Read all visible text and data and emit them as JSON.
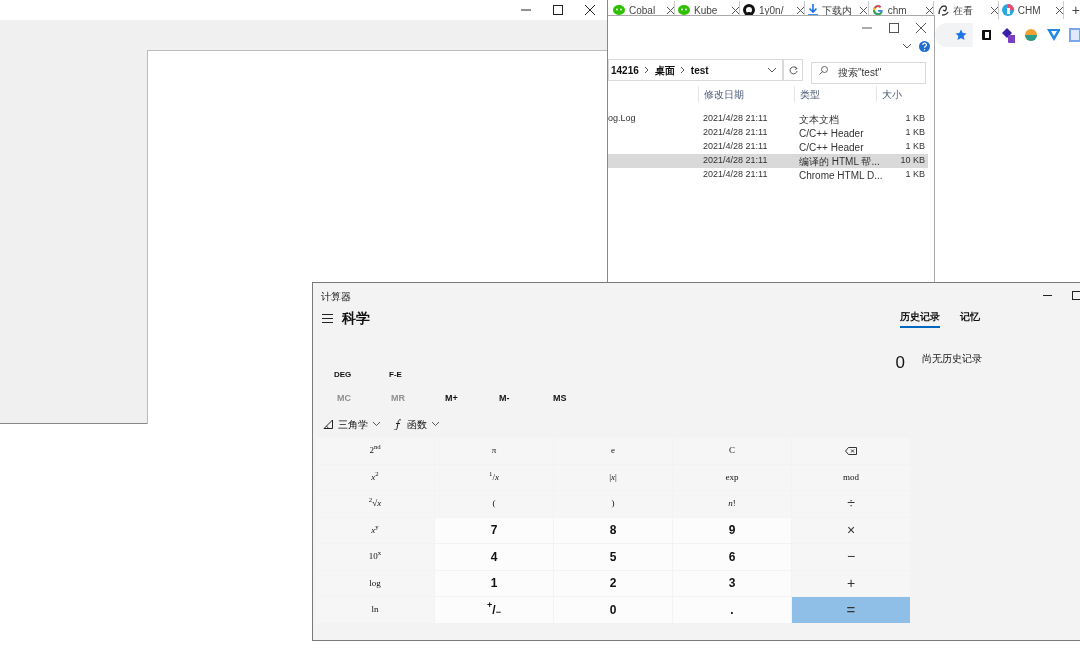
{
  "browser": {
    "tabs": [
      {
        "label": "Cobal"
      },
      {
        "label": "Kube"
      },
      {
        "label": "1y0n/"
      },
      {
        "label": "下载内"
      },
      {
        "label": "chm"
      },
      {
        "label": "在看"
      },
      {
        "label": "CHM"
      }
    ],
    "new_tab": "+"
  },
  "explorer": {
    "breadcrumb": [
      "14216",
      "桌面",
      "test"
    ],
    "search": {
      "placeholder": "搜索\"test\""
    },
    "columns": [
      "修改日期",
      "类型",
      "大小"
    ],
    "rows": [
      {
        "name": "og.Log",
        "date": "2021/4/28 21:11",
        "type": "文本文档",
        "size": "1 KB",
        "selected": false
      },
      {
        "date": "2021/4/28 21:11",
        "type": "C/C++ Header",
        "size": "1 KB",
        "selected": false
      },
      {
        "date": "2021/4/28 21:11",
        "type": "C/C++ Header",
        "size": "1 KB",
        "selected": false
      },
      {
        "date": "2021/4/28 21:11",
        "type": "编译的 HTML 帮...",
        "size": "10 KB",
        "selected": true
      },
      {
        "date": "2021/4/28 21:11",
        "type": "Chrome HTML D...",
        "size": "1 KB",
        "selected": false
      }
    ]
  },
  "calculator": {
    "title": "计算器",
    "mode": "科学",
    "tabs": [
      {
        "label": "历史记录",
        "selected": true
      },
      {
        "label": "记忆",
        "selected": false
      }
    ],
    "display": "0",
    "history_empty": "尚无历史记录",
    "angle_buttons": [
      "DEG",
      "F-E"
    ],
    "memory_buttons": [
      {
        "label": "MC",
        "disabled": true
      },
      {
        "label": "MR",
        "disabled": true
      },
      {
        "label": "M+",
        "disabled": false
      },
      {
        "label": "M-",
        "disabled": false
      },
      {
        "label": "MS",
        "disabled": false
      }
    ],
    "dropdowns": [
      "三角学",
      "函数"
    ],
    "keys": [
      [
        {
          "label": "2$^{nd}$",
          "kind": "function"
        },
        {
          "label": "π",
          "kind": "function"
        },
        {
          "label": "e",
          "kind": "function"
        },
        {
          "label": "C",
          "kind": "function"
        },
        {
          "kind": "backspace"
        }
      ],
      [
        {
          "label": "*x*$^{2}$",
          "kind": "function"
        },
        {
          "label": "$^{1}$/*x*",
          "kind": "function"
        },
        {
          "label": "|*x*|",
          "kind": "function"
        },
        {
          "label": "exp",
          "kind": "function"
        },
        {
          "label": "mod",
          "kind": "function"
        }
      ],
      [
        {
          "label": "$^{2}$√*x*",
          "kind": "function"
        },
        {
          "label": "(",
          "kind": "function"
        },
        {
          "label": ")",
          "kind": "function"
        },
        {
          "label": "*n*!",
          "kind": "function"
        },
        {
          "label": "÷",
          "kind": "operator"
        }
      ],
      [
        {
          "label": "*x*$^{y}$",
          "kind": "function"
        },
        {
          "label": "7",
          "kind": "number"
        },
        {
          "label": "8",
          "kind": "number"
        },
        {
          "label": "9",
          "kind": "number"
        },
        {
          "label": "×",
          "kind": "operator"
        }
      ],
      [
        {
          "label": "10$^{x}$",
          "kind": "function"
        },
        {
          "label": "4",
          "kind": "number"
        },
        {
          "label": "5",
          "kind": "number"
        },
        {
          "label": "6",
          "kind": "number"
        },
        {
          "label": "−",
          "kind": "operator"
        }
      ],
      [
        {
          "label": "log",
          "kind": "function"
        },
        {
          "label": "1",
          "kind": "number"
        },
        {
          "label": "2",
          "kind": "number"
        },
        {
          "label": "3",
          "kind": "number"
        },
        {
          "label": "+",
          "kind": "operator"
        }
      ],
      [
        {
          "label": "ln",
          "kind": "function"
        },
        {
          "label": "$^{+}$/$_{−}$",
          "kind": "number"
        },
        {
          "label": "0",
          "kind": "number"
        },
        {
          "label": ".",
          "kind": "number"
        },
        {
          "label": "=",
          "kind": "equals"
        }
      ]
    ]
  }
}
